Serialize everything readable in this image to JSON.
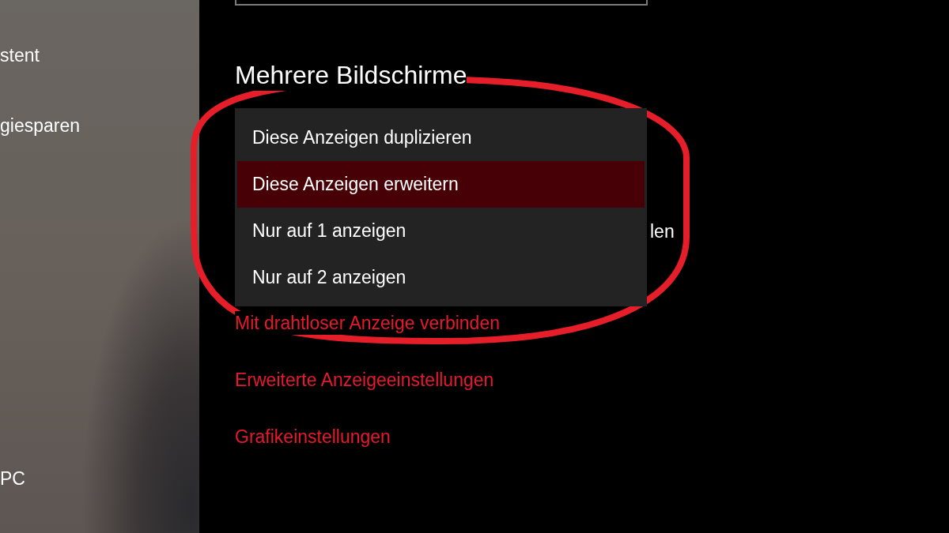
{
  "sidebar": {
    "items": [
      {
        "label": "stent"
      },
      {
        "label": "giesparen"
      },
      {
        "label": "PC"
      }
    ]
  },
  "main": {
    "heading": "Mehrere Bildschirme",
    "hidden_text": "len",
    "links": [
      {
        "label": "Mit drahtloser Anzeige verbinden"
      },
      {
        "label": "Erweiterte Anzeigeeinstellungen"
      },
      {
        "label": "Grafikeinstellungen"
      }
    ]
  },
  "dropdown": {
    "options": [
      {
        "label": "Diese Anzeigen duplizieren",
        "selected": false
      },
      {
        "label": "Diese Anzeigen erweitern",
        "selected": true
      },
      {
        "label": "Nur auf 1 anzeigen",
        "selected": false
      },
      {
        "label": "Nur auf 2 anzeigen",
        "selected": false
      }
    ]
  },
  "annotation": {
    "kind": "oval"
  }
}
